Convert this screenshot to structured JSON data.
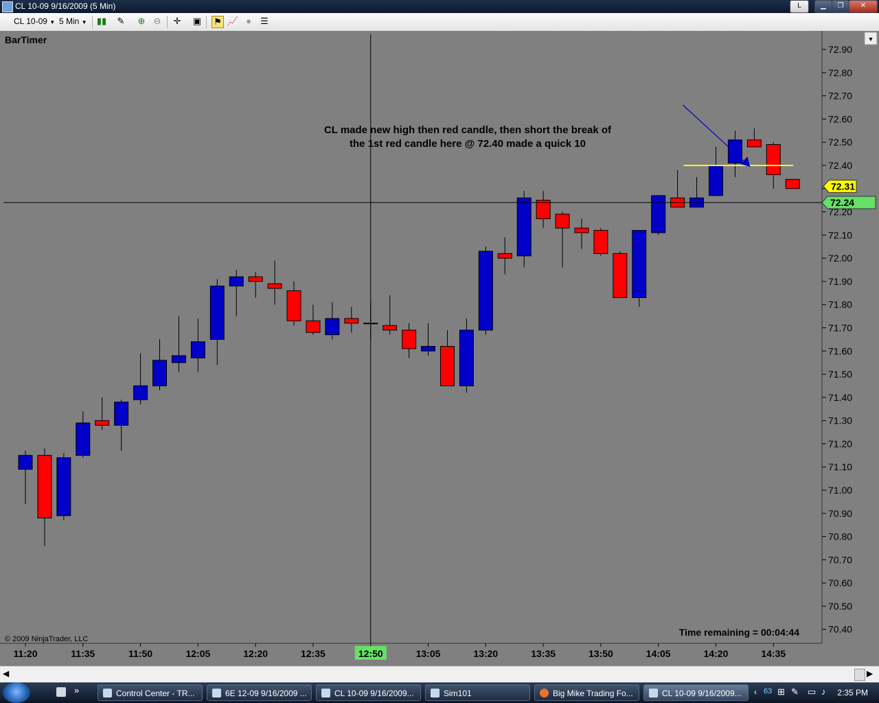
{
  "window": {
    "title": "CL 10-09  9/16/2009 (5 Min)",
    "restore_label": "L"
  },
  "toolbar": {
    "instrument": "CL 10-09",
    "interval": "5 Min"
  },
  "chart_data": {
    "type": "candlestick",
    "indicator_label": "BarTimer",
    "copyright": "© 2009 NinjaTrader, LLC",
    "time_remaining": "Time remaining = 00:04:44",
    "annotation": [
      "CL made new high then red candle, then short the break of",
      "the 1st red candle here @ 72.40 made a quick 10"
    ],
    "ylim": [
      70.34,
      72.98
    ],
    "y_ticks": [
      "72.90",
      "72.80",
      "72.70",
      "72.60",
      "72.50",
      "72.40",
      "72.30",
      "72.20",
      "72.10",
      "72.00",
      "71.90",
      "71.80",
      "71.70",
      "71.60",
      "71.50",
      "71.40",
      "71.30",
      "71.20",
      "71.10",
      "71.00",
      "70.90",
      "70.80",
      "70.70",
      "70.60",
      "70.50",
      "70.40"
    ],
    "x_ticks": [
      "11:20",
      "11:35",
      "11:50",
      "12:05",
      "12:20",
      "12:35",
      "12:50",
      "13:05",
      "13:20",
      "13:35",
      "13:50",
      "14:05",
      "14:20",
      "14:35"
    ],
    "x_tick_bar_index": [
      0,
      3,
      6,
      9,
      12,
      15,
      18,
      21,
      24,
      27,
      30,
      33,
      36,
      39
    ],
    "crosshair": {
      "x_label": "12:50",
      "x_bar_index": 18,
      "y_label": "72.24",
      "y": 72.24
    },
    "last_price": "72.31",
    "last_price_value": 72.31,
    "entry_level": {
      "value": 72.4,
      "from_bar": 35,
      "to_bar": 40,
      "color": "#ffff00"
    },
    "colors": {
      "up": "#0000c8",
      "down": "#ff0000",
      "background": "#808080",
      "axis_bg": "#808080",
      "last_price_bg": "#ffff00",
      "crosshair_bg": "#66e066"
    },
    "bars": [
      {
        "time": "11:20",
        "o": 71.09,
        "h": 71.17,
        "l": 70.94,
        "c": 71.15
      },
      {
        "time": "11:25",
        "o": 71.15,
        "h": 71.18,
        "l": 70.76,
        "c": 70.88
      },
      {
        "time": "11:30",
        "o": 70.89,
        "h": 71.16,
        "l": 70.87,
        "c": 71.14
      },
      {
        "time": "11:35",
        "o": 71.15,
        "h": 71.34,
        "l": 71.14,
        "c": 71.29
      },
      {
        "time": "11:40",
        "o": 71.3,
        "h": 71.4,
        "l": 71.26,
        "c": 71.28
      },
      {
        "time": "11:45",
        "o": 71.28,
        "h": 71.39,
        "l": 71.17,
        "c": 71.38
      },
      {
        "time": "11:50",
        "o": 71.39,
        "h": 71.59,
        "l": 71.37,
        "c": 71.45
      },
      {
        "time": "11:55",
        "o": 71.45,
        "h": 71.65,
        "l": 71.43,
        "c": 71.56
      },
      {
        "time": "12:00",
        "o": 71.55,
        "h": 71.75,
        "l": 71.51,
        "c": 71.58
      },
      {
        "time": "12:05",
        "o": 71.57,
        "h": 71.74,
        "l": 71.51,
        "c": 71.64
      },
      {
        "time": "12:10",
        "o": 71.65,
        "h": 71.91,
        "l": 71.54,
        "c": 71.88
      },
      {
        "time": "12:15",
        "o": 71.88,
        "h": 71.95,
        "l": 71.75,
        "c": 71.92
      },
      {
        "time": "12:20",
        "o": 71.92,
        "h": 71.94,
        "l": 71.83,
        "c": 71.9
      },
      {
        "time": "12:25",
        "o": 71.89,
        "h": 71.99,
        "l": 71.8,
        "c": 71.87
      },
      {
        "time": "12:30",
        "o": 71.86,
        "h": 71.9,
        "l": 71.71,
        "c": 71.73
      },
      {
        "time": "12:35",
        "o": 71.73,
        "h": 71.8,
        "l": 71.67,
        "c": 71.68
      },
      {
        "time": "12:40",
        "o": 71.67,
        "h": 71.81,
        "l": 71.65,
        "c": 71.74
      },
      {
        "time": "12:45",
        "o": 71.74,
        "h": 71.79,
        "l": 71.68,
        "c": 71.72
      },
      {
        "time": "12:50",
        "o": 71.72,
        "h": 71.81,
        "l": 71.65,
        "c": 71.72
      },
      {
        "time": "12:55",
        "o": 71.71,
        "h": 71.84,
        "l": 71.67,
        "c": 71.69
      },
      {
        "time": "13:00",
        "o": 71.69,
        "h": 71.72,
        "l": 71.57,
        "c": 71.61
      },
      {
        "time": "13:05",
        "o": 71.6,
        "h": 71.72,
        "l": 71.58,
        "c": 71.62
      },
      {
        "time": "13:10",
        "o": 71.62,
        "h": 71.69,
        "l": 71.45,
        "c": 71.45
      },
      {
        "time": "13:15",
        "o": 71.45,
        "h": 71.74,
        "l": 71.42,
        "c": 71.69
      },
      {
        "time": "13:20",
        "o": 71.69,
        "h": 72.05,
        "l": 71.67,
        "c": 72.03
      },
      {
        "time": "13:25",
        "o": 72.02,
        "h": 72.09,
        "l": 71.93,
        "c": 72.0
      },
      {
        "time": "13:30",
        "o": 72.01,
        "h": 72.29,
        "l": 71.96,
        "c": 72.26
      },
      {
        "time": "13:35",
        "o": 72.25,
        "h": 72.29,
        "l": 72.13,
        "c": 72.17
      },
      {
        "time": "13:40",
        "o": 72.19,
        "h": 72.2,
        "l": 71.96,
        "c": 72.13
      },
      {
        "time": "13:45",
        "o": 72.13,
        "h": 72.17,
        "l": 72.04,
        "c": 72.11
      },
      {
        "time": "13:50",
        "o": 72.12,
        "h": 72.13,
        "l": 72.01,
        "c": 72.02
      },
      {
        "time": "13:55",
        "o": 72.02,
        "h": 72.03,
        "l": 71.83,
        "c": 71.83
      },
      {
        "time": "14:00",
        "o": 71.83,
        "h": 72.12,
        "l": 71.79,
        "c": 72.12
      },
      {
        "time": "14:05",
        "o": 72.11,
        "h": 72.27,
        "l": 72.1,
        "c": 72.27
      },
      {
        "time": "14:10",
        "o": 72.26,
        "h": 72.38,
        "l": 72.22,
        "c": 72.22
      },
      {
        "time": "14:15",
        "o": 72.22,
        "h": 72.35,
        "l": 72.22,
        "c": 72.26
      },
      {
        "time": "14:20",
        "o": 72.27,
        "h": 72.48,
        "l": 72.27,
        "c": 72.4
      },
      {
        "time": "14:25",
        "o": 72.41,
        "h": 72.55,
        "l": 72.35,
        "c": 72.51
      },
      {
        "time": "14:30",
        "o": 72.51,
        "h": 72.56,
        "l": 72.48,
        "c": 72.48
      },
      {
        "time": "14:35",
        "o": 72.49,
        "h": 72.5,
        "l": 72.3,
        "c": 72.36
      },
      {
        "time": "14:40",
        "o": 72.34,
        "h": 72.34,
        "l": 72.3,
        "c": 72.3
      }
    ]
  },
  "taskbar": {
    "items": [
      {
        "label": "Control Center - TR..."
      },
      {
        "label": "6E 12-09  9/16/2009 ..."
      },
      {
        "label": "CL 10-09  9/16/2009..."
      },
      {
        "label": "Sim101"
      },
      {
        "label": "Big Mike Trading Fo..."
      },
      {
        "label": "CL 10-09  9/16/2009..."
      }
    ],
    "tray_temp": "63",
    "clock": "2:35 PM"
  }
}
